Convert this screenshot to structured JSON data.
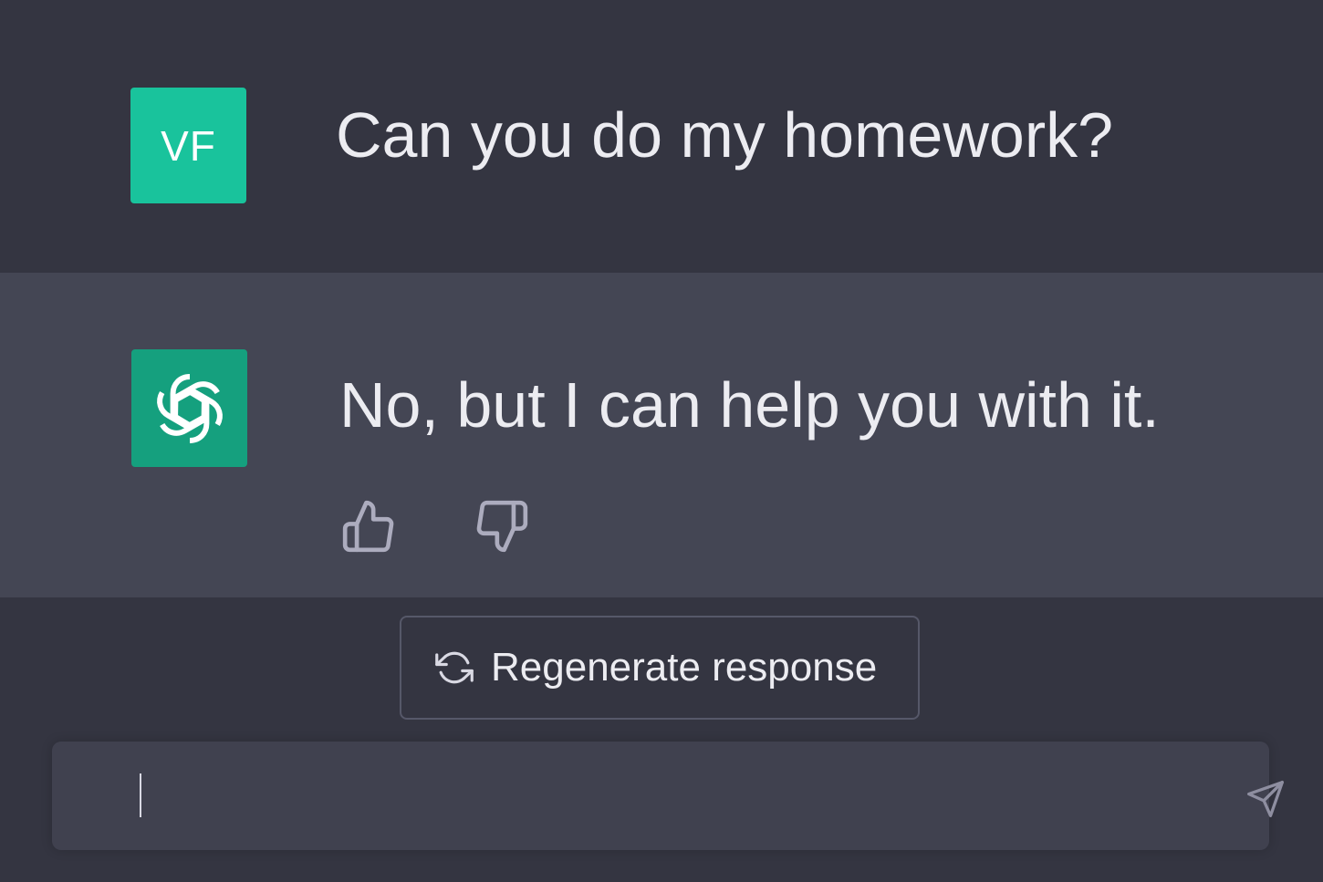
{
  "conversation": {
    "user": {
      "avatar_initials": "VF",
      "avatar_color": "#19c39c",
      "message": "Can you do my homework?"
    },
    "assistant": {
      "avatar_icon": "openai-logo-icon",
      "avatar_color": "#15a07e",
      "message": "No, but I can help you with it."
    }
  },
  "actions": {
    "thumbs_up_icon": "thumbs-up-icon",
    "thumbs_down_icon": "thumbs-down-icon",
    "regenerate_label": "Regenerate response",
    "regenerate_icon": "refresh-icon"
  },
  "composer": {
    "value": "",
    "send_icon": "send-icon"
  },
  "colors": {
    "background": "#343541",
    "assistant_row": "#444654",
    "input_background": "#40414f",
    "text": "#ececf1"
  }
}
